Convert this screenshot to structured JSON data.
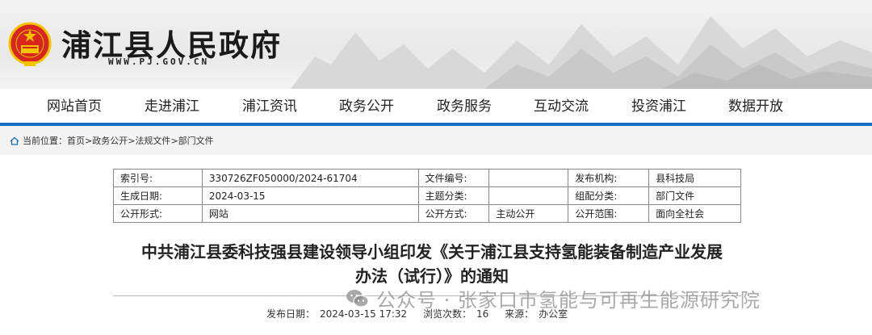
{
  "header": {
    "site_title": "浦江县人民政府",
    "site_url": "WWW.PJ.GOV.CN"
  },
  "nav": {
    "items": [
      "网站首页",
      "走进浦江",
      "浦江资讯",
      "政务公开",
      "政务服务",
      "互动交流",
      "投资浦江",
      "数据开放"
    ]
  },
  "breadcrumb": {
    "prefix": "当前位置：",
    "path": [
      "首页",
      "政务公开",
      "法规文件",
      "部门文件"
    ],
    "separator": ">"
  },
  "info_table": {
    "rows": [
      [
        "索引号:",
        "330726ZF050000/2024-61704",
        "文件编号:",
        "",
        "发布机构:",
        "县科技局"
      ],
      [
        "生成日期:",
        "2024-03-15",
        "主题分类:",
        "",
        "组配分类:",
        "部门文件"
      ],
      [
        "公开形式:",
        "网站",
        "公开方式:",
        "主动公开",
        "公开范围:",
        "面向全社会"
      ]
    ]
  },
  "article": {
    "title_line1": "中共浦江县委科技强县建设领导小组印发《关于浦江县支持氢能装备制造产业发展",
    "title_line2": "办法（试行）》的通知",
    "publish_label": "发布日期：",
    "publish_date": "2024-03-15 17:32",
    "views_label": "浏览次数：",
    "views": "16",
    "source_label": "来源：",
    "source": "办公室"
  },
  "watermark": {
    "text": "公众号 · 张家口市氢能与可再生能源研究院"
  },
  "colors": {
    "nav_accent": "#1a6fc4",
    "emblem_red": "#d7261e",
    "emblem_gold": "#f5c400"
  }
}
